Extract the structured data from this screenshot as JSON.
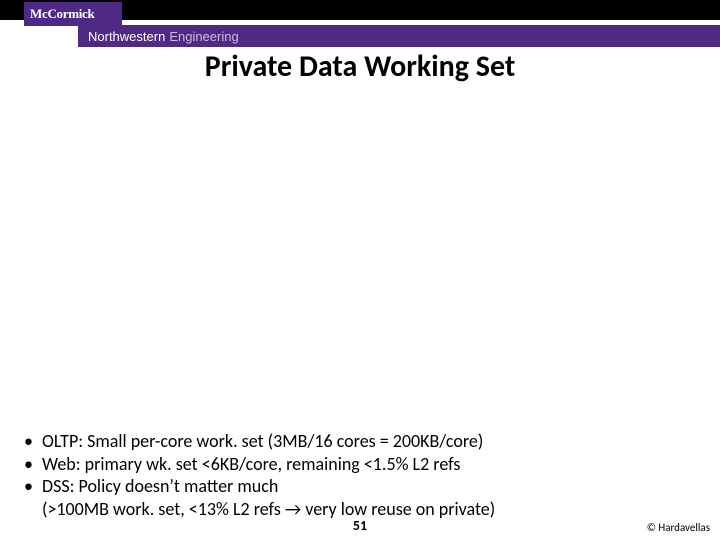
{
  "header": {
    "logo_text": "McCormick",
    "subbrand_left": "Northwestern",
    "subbrand_right": "Engineering"
  },
  "slide": {
    "title": "Private Data Working Set",
    "bullets": [
      "OLTP: Small per-core work. set (3MB/16 cores = 200KB/core)",
      "Web: primary wk. set <6KB/core, remaining <1.5% L2 refs",
      "DSS: Policy doesn’t matter much",
      "(>100MB work. set, <13% L2 refs → very low reuse on private)"
    ],
    "page_number": "51",
    "copyright": "© Hardavellas"
  }
}
